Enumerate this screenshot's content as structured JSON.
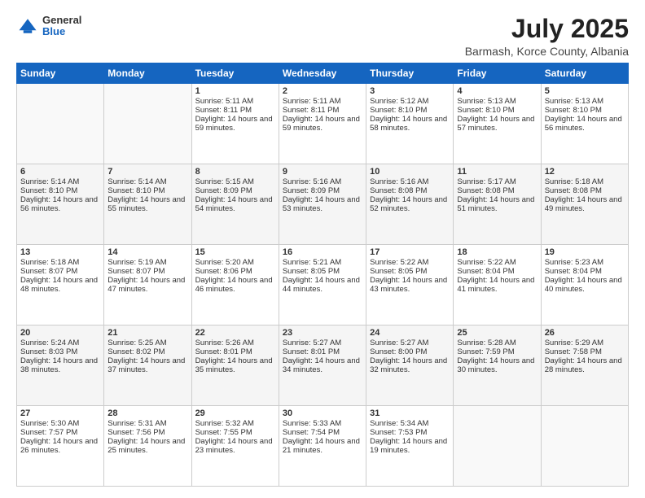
{
  "header": {
    "logo_general": "General",
    "logo_blue": "Blue",
    "main_title": "July 2025",
    "subtitle": "Barmash, Korce County, Albania"
  },
  "weekdays": [
    "Sunday",
    "Monday",
    "Tuesday",
    "Wednesday",
    "Thursday",
    "Friday",
    "Saturday"
  ],
  "weeks": [
    [
      {
        "day": "",
        "sunrise": "",
        "sunset": "",
        "daylight": ""
      },
      {
        "day": "",
        "sunrise": "",
        "sunset": "",
        "daylight": ""
      },
      {
        "day": "1",
        "sunrise": "Sunrise: 5:11 AM",
        "sunset": "Sunset: 8:11 PM",
        "daylight": "Daylight: 14 hours and 59 minutes."
      },
      {
        "day": "2",
        "sunrise": "Sunrise: 5:11 AM",
        "sunset": "Sunset: 8:11 PM",
        "daylight": "Daylight: 14 hours and 59 minutes."
      },
      {
        "day": "3",
        "sunrise": "Sunrise: 5:12 AM",
        "sunset": "Sunset: 8:10 PM",
        "daylight": "Daylight: 14 hours and 58 minutes."
      },
      {
        "day": "4",
        "sunrise": "Sunrise: 5:13 AM",
        "sunset": "Sunset: 8:10 PM",
        "daylight": "Daylight: 14 hours and 57 minutes."
      },
      {
        "day": "5",
        "sunrise": "Sunrise: 5:13 AM",
        "sunset": "Sunset: 8:10 PM",
        "daylight": "Daylight: 14 hours and 56 minutes."
      }
    ],
    [
      {
        "day": "6",
        "sunrise": "Sunrise: 5:14 AM",
        "sunset": "Sunset: 8:10 PM",
        "daylight": "Daylight: 14 hours and 56 minutes."
      },
      {
        "day": "7",
        "sunrise": "Sunrise: 5:14 AM",
        "sunset": "Sunset: 8:10 PM",
        "daylight": "Daylight: 14 hours and 55 minutes."
      },
      {
        "day": "8",
        "sunrise": "Sunrise: 5:15 AM",
        "sunset": "Sunset: 8:09 PM",
        "daylight": "Daylight: 14 hours and 54 minutes."
      },
      {
        "day": "9",
        "sunrise": "Sunrise: 5:16 AM",
        "sunset": "Sunset: 8:09 PM",
        "daylight": "Daylight: 14 hours and 53 minutes."
      },
      {
        "day": "10",
        "sunrise": "Sunrise: 5:16 AM",
        "sunset": "Sunset: 8:08 PM",
        "daylight": "Daylight: 14 hours and 52 minutes."
      },
      {
        "day": "11",
        "sunrise": "Sunrise: 5:17 AM",
        "sunset": "Sunset: 8:08 PM",
        "daylight": "Daylight: 14 hours and 51 minutes."
      },
      {
        "day": "12",
        "sunrise": "Sunrise: 5:18 AM",
        "sunset": "Sunset: 8:08 PM",
        "daylight": "Daylight: 14 hours and 49 minutes."
      }
    ],
    [
      {
        "day": "13",
        "sunrise": "Sunrise: 5:18 AM",
        "sunset": "Sunset: 8:07 PM",
        "daylight": "Daylight: 14 hours and 48 minutes."
      },
      {
        "day": "14",
        "sunrise": "Sunrise: 5:19 AM",
        "sunset": "Sunset: 8:07 PM",
        "daylight": "Daylight: 14 hours and 47 minutes."
      },
      {
        "day": "15",
        "sunrise": "Sunrise: 5:20 AM",
        "sunset": "Sunset: 8:06 PM",
        "daylight": "Daylight: 14 hours and 46 minutes."
      },
      {
        "day": "16",
        "sunrise": "Sunrise: 5:21 AM",
        "sunset": "Sunset: 8:05 PM",
        "daylight": "Daylight: 14 hours and 44 minutes."
      },
      {
        "day": "17",
        "sunrise": "Sunrise: 5:22 AM",
        "sunset": "Sunset: 8:05 PM",
        "daylight": "Daylight: 14 hours and 43 minutes."
      },
      {
        "day": "18",
        "sunrise": "Sunrise: 5:22 AM",
        "sunset": "Sunset: 8:04 PM",
        "daylight": "Daylight: 14 hours and 41 minutes."
      },
      {
        "day": "19",
        "sunrise": "Sunrise: 5:23 AM",
        "sunset": "Sunset: 8:04 PM",
        "daylight": "Daylight: 14 hours and 40 minutes."
      }
    ],
    [
      {
        "day": "20",
        "sunrise": "Sunrise: 5:24 AM",
        "sunset": "Sunset: 8:03 PM",
        "daylight": "Daylight: 14 hours and 38 minutes."
      },
      {
        "day": "21",
        "sunrise": "Sunrise: 5:25 AM",
        "sunset": "Sunset: 8:02 PM",
        "daylight": "Daylight: 14 hours and 37 minutes."
      },
      {
        "day": "22",
        "sunrise": "Sunrise: 5:26 AM",
        "sunset": "Sunset: 8:01 PM",
        "daylight": "Daylight: 14 hours and 35 minutes."
      },
      {
        "day": "23",
        "sunrise": "Sunrise: 5:27 AM",
        "sunset": "Sunset: 8:01 PM",
        "daylight": "Daylight: 14 hours and 34 minutes."
      },
      {
        "day": "24",
        "sunrise": "Sunrise: 5:27 AM",
        "sunset": "Sunset: 8:00 PM",
        "daylight": "Daylight: 14 hours and 32 minutes."
      },
      {
        "day": "25",
        "sunrise": "Sunrise: 5:28 AM",
        "sunset": "Sunset: 7:59 PM",
        "daylight": "Daylight: 14 hours and 30 minutes."
      },
      {
        "day": "26",
        "sunrise": "Sunrise: 5:29 AM",
        "sunset": "Sunset: 7:58 PM",
        "daylight": "Daylight: 14 hours and 28 minutes."
      }
    ],
    [
      {
        "day": "27",
        "sunrise": "Sunrise: 5:30 AM",
        "sunset": "Sunset: 7:57 PM",
        "daylight": "Daylight: 14 hours and 26 minutes."
      },
      {
        "day": "28",
        "sunrise": "Sunrise: 5:31 AM",
        "sunset": "Sunset: 7:56 PM",
        "daylight": "Daylight: 14 hours and 25 minutes."
      },
      {
        "day": "29",
        "sunrise": "Sunrise: 5:32 AM",
        "sunset": "Sunset: 7:55 PM",
        "daylight": "Daylight: 14 hours and 23 minutes."
      },
      {
        "day": "30",
        "sunrise": "Sunrise: 5:33 AM",
        "sunset": "Sunset: 7:54 PM",
        "daylight": "Daylight: 14 hours and 21 minutes."
      },
      {
        "day": "31",
        "sunrise": "Sunrise: 5:34 AM",
        "sunset": "Sunset: 7:53 PM",
        "daylight": "Daylight: 14 hours and 19 minutes."
      },
      {
        "day": "",
        "sunrise": "",
        "sunset": "",
        "daylight": ""
      },
      {
        "day": "",
        "sunrise": "",
        "sunset": "",
        "daylight": ""
      }
    ]
  ]
}
